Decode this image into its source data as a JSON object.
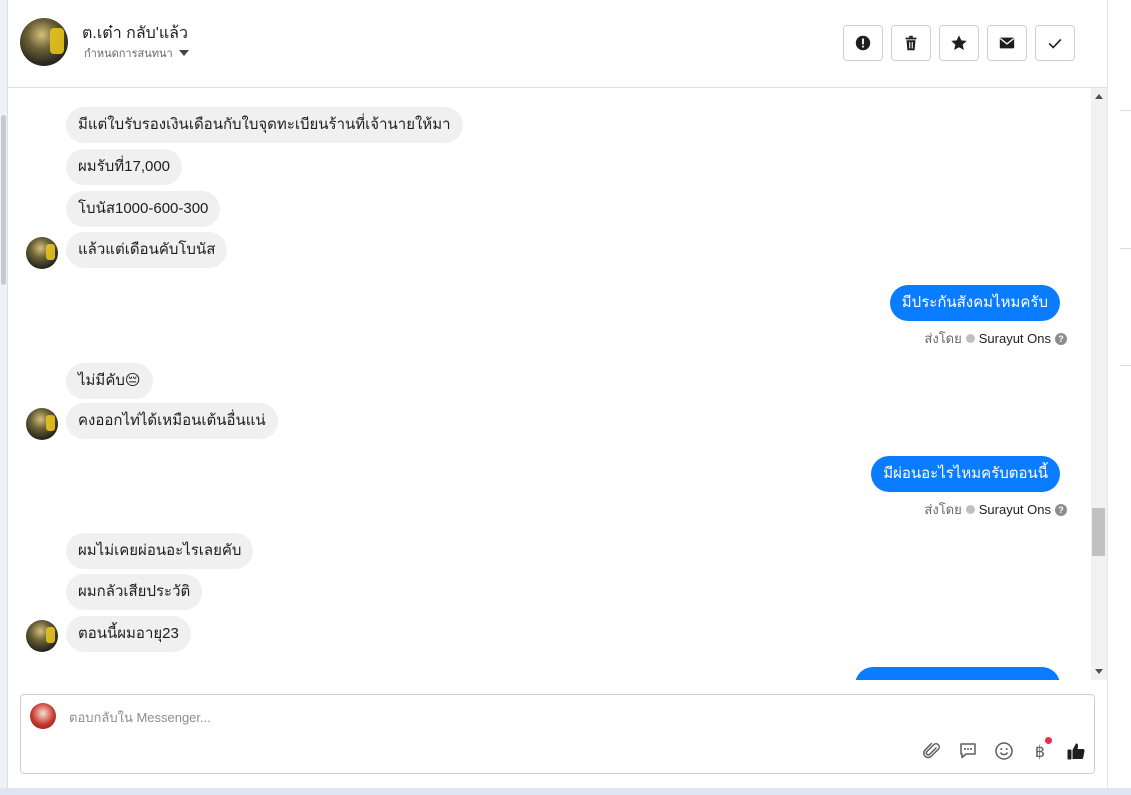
{
  "header": {
    "name": "ต.เต๋า กลับ'แล้ว",
    "subtitle": "กำหนดการสนทนา",
    "actions": [
      {
        "name": "spam-button",
        "icon": "exclamation-icon"
      },
      {
        "name": "delete-button",
        "icon": "trash-icon"
      },
      {
        "name": "star-button",
        "icon": "star-icon"
      },
      {
        "name": "mark-unread-button",
        "icon": "envelope-icon"
      },
      {
        "name": "done-button",
        "icon": "check-icon"
      }
    ]
  },
  "messages": [
    {
      "side": "in",
      "text": "มีแต่ใบรับรองเงินเดือนกับใบจุดทะเบียนร้านที่เจ้านายให้มา"
    },
    {
      "side": "in",
      "text": "ผมรับที่17,000"
    },
    {
      "side": "in",
      "text": "โบนัส1000-600-300"
    },
    {
      "side": "in",
      "text": "แล้วแต่เดือนคับโบนัส"
    },
    {
      "side": "out",
      "text": "มีประกันสังคมไหมครับ"
    },
    {
      "side": "in",
      "text": "ไม่มีคับ😔"
    },
    {
      "side": "in",
      "text": "คงออกไท่ได้เหมือนเต้นอื่นแน่"
    },
    {
      "side": "out",
      "text": "มีผ่อนอะไรไหมครับตอนนี้"
    },
    {
      "side": "in",
      "text": "ผมไม่เคยผ่อนอะไรเลยคับ"
    },
    {
      "side": "in",
      "text": "ผมกลัวเสียประวัติ"
    },
    {
      "side": "in",
      "text": "ตอนนี้ผมอายุ23"
    }
  ],
  "sent_by": {
    "label": "ส่งโดย",
    "name": "Surayut Ons"
  },
  "composer": {
    "placeholder": "ตอบกลับใน Messenger...",
    "baht_symbol": "฿"
  },
  "colors": {
    "outgoing": "#0a7cff",
    "incoming": "#f0f0f0",
    "badge": "#f02849"
  }
}
